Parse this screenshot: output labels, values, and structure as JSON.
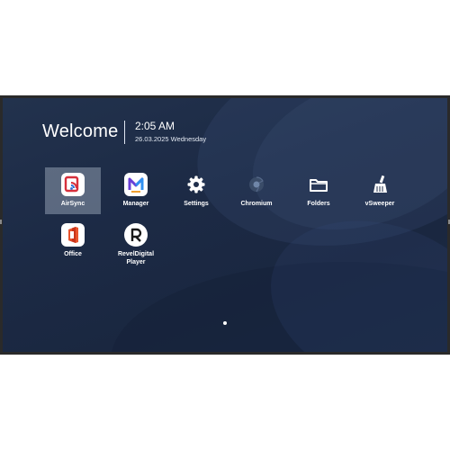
{
  "home": {
    "welcome": "Welcome",
    "time": "2:05 AM",
    "date": "26.03.2025 Wednesday"
  },
  "apps": [
    {
      "label": "AirSync",
      "icon": "airsync-icon",
      "selected": true
    },
    {
      "label": "Manager",
      "icon": "manager-icon"
    },
    {
      "label": "Settings",
      "icon": "gear-icon"
    },
    {
      "label": "Chromium",
      "icon": "chromium-icon"
    },
    {
      "label": "Folders",
      "icon": "folder-icon"
    },
    {
      "label": "vSweeper",
      "icon": "broom-icon"
    },
    {
      "label": "Office",
      "icon": "office-icon"
    },
    {
      "label": "RevelDigital Player",
      "icon": "reveldigital-icon"
    }
  ],
  "pager": {
    "pages": 1,
    "current": 1
  },
  "colors": {
    "background": "#1c2a45",
    "airsync_red": "#d6303c",
    "manager_purple": "#6a3fd6",
    "manager_blue": "#2f8ff0",
    "office_orange": "#e8532c"
  }
}
